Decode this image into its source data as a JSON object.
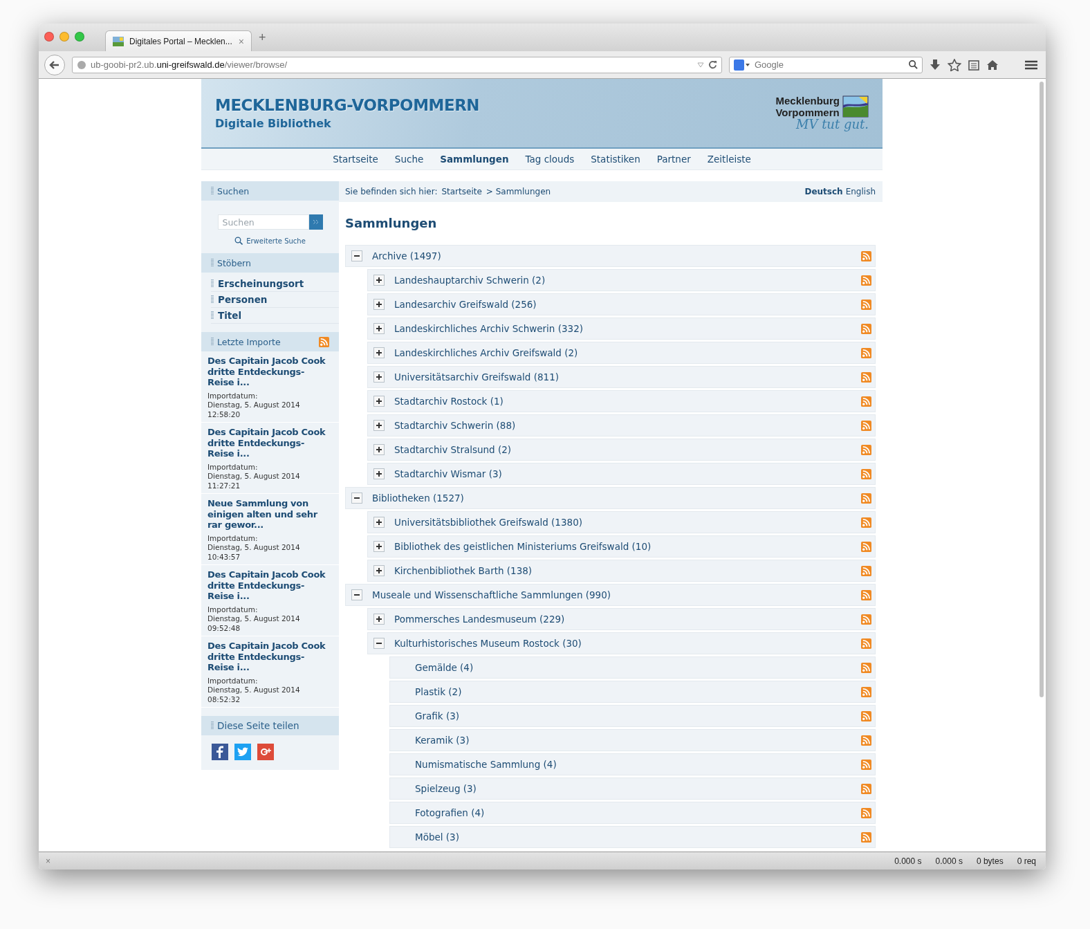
{
  "browser": {
    "tab_title": "Digitales Portal – Mecklen...",
    "close_tab": "×",
    "new_tab": "+",
    "url_prefix": "ub-goobi-pr2.ub.",
    "url_domain": "uni-greifswald.de",
    "url_path": "/viewer/browse/",
    "search_placeholder": "Google"
  },
  "header": {
    "title": "MECKLENBURG-VORPOMMERN",
    "subtitle": "Digitale Bibliothek",
    "logo_line1": "Mecklenburg",
    "logo_line2": "Vorpommern",
    "logo_slogan": "MV tut gut."
  },
  "nav": [
    {
      "label": "Startseite",
      "selected": false
    },
    {
      "label": "Suche",
      "selected": false
    },
    {
      "label": "Sammlungen",
      "selected": true
    },
    {
      "label": "Tag clouds",
      "selected": false
    },
    {
      "label": "Statistiken",
      "selected": false
    },
    {
      "label": "Partner",
      "selected": false
    },
    {
      "label": "Zeitleiste",
      "selected": false
    }
  ],
  "sidebar": {
    "search_title": "Suchen",
    "search_placeholder": "Suchen",
    "advanced_search": "Erweiterte Suche",
    "browse_title": "Stöbern",
    "browse_items": [
      "Erscheinungsort",
      "Personen",
      "Titel"
    ],
    "imports_title": "Letzte Importe",
    "imports": [
      {
        "title": "Des Capitain Jacob Cook dritte Entdeckungs-Reise i...",
        "label": "Importdatum:",
        "date": "Dienstag, 5. August 2014",
        "time": "12:58:20"
      },
      {
        "title": "Des Capitain Jacob Cook dritte Entdeckungs-Reise i...",
        "label": "Importdatum:",
        "date": "Dienstag, 5. August 2014",
        "time": "11:27:21"
      },
      {
        "title": "Neue Sammlung von einigen alten und sehr rar gewor...",
        "label": "Importdatum:",
        "date": "Dienstag, 5. August 2014",
        "time": "10:43:57"
      },
      {
        "title": "Des Capitain Jacob Cook dritte Entdeckungs-Reise i...",
        "label": "Importdatum:",
        "date": "Dienstag, 5. August 2014",
        "time": "09:52:48"
      },
      {
        "title": "Des Capitain Jacob Cook dritte Entdeckungs-Reise i...",
        "label": "Importdatum:",
        "date": "Dienstag, 5. August 2014",
        "time": "08:52:32"
      }
    ],
    "share_title": "Diese Seite teilen"
  },
  "breadcrumb": {
    "prefix": "Sie befinden sich hier:",
    "items": [
      "Startseite",
      "> Sammlungen"
    ]
  },
  "languages": [
    {
      "label": "Deutsch",
      "selected": true
    },
    {
      "label": "English",
      "selected": false
    }
  ],
  "page_title": "Sammlungen",
  "tree": [
    {
      "label": "Archive (1497)",
      "kind": "group",
      "expanded": true,
      "children": [
        {
          "label": "Landeshauptarchiv Schwerin (2)",
          "kind": "group",
          "expanded": false
        },
        {
          "label": "Landesarchiv Greifswald (256)",
          "kind": "group",
          "expanded": false
        },
        {
          "label": "Landeskirchliches Archiv Schwerin (332)",
          "kind": "group",
          "expanded": false
        },
        {
          "label": "Landeskirchliches Archiv Greifswald (2)",
          "kind": "group",
          "expanded": false
        },
        {
          "label": "Universitätsarchiv Greifswald (811)",
          "kind": "group",
          "expanded": false
        },
        {
          "label": "Stadtarchiv Rostock (1)",
          "kind": "group",
          "expanded": false
        },
        {
          "label": "Stadtarchiv Schwerin (88)",
          "kind": "group",
          "expanded": false
        },
        {
          "label": "Stadtarchiv Stralsund (2)",
          "kind": "group",
          "expanded": false
        },
        {
          "label": "Stadtarchiv Wismar (3)",
          "kind": "group",
          "expanded": false
        }
      ]
    },
    {
      "label": "Bibliotheken (1527)",
      "kind": "group",
      "expanded": true,
      "children": [
        {
          "label": "Universitätsbibliothek Greifswald (1380)",
          "kind": "group",
          "expanded": false
        },
        {
          "label": "Bibliothek des geistlichen Ministeriums Greifswald (10)",
          "kind": "group",
          "expanded": false
        },
        {
          "label": "Kirchenbibliothek Barth (138)",
          "kind": "group",
          "expanded": false
        }
      ]
    },
    {
      "label": "Museale und Wissenschaftliche Sammlungen (990)",
      "kind": "group",
      "expanded": true,
      "children": [
        {
          "label": "Pommersches Landesmuseum (229)",
          "kind": "group",
          "expanded": false
        },
        {
          "label": "Kulturhistorisches Museum Rostock (30)",
          "kind": "group",
          "expanded": true,
          "children": [
            {
              "label": "Gemälde (4)",
              "kind": "leaf"
            },
            {
              "label": "Plastik (2)",
              "kind": "leaf"
            },
            {
              "label": "Grafik (3)",
              "kind": "leaf"
            },
            {
              "label": "Keramik (3)",
              "kind": "leaf"
            },
            {
              "label": "Numismatische Sammlung (4)",
              "kind": "leaf"
            },
            {
              "label": "Spielzeug (3)",
              "kind": "leaf"
            },
            {
              "label": "Fotografien (4)",
              "kind": "leaf"
            },
            {
              "label": "Möbel (3)",
              "kind": "leaf"
            }
          ]
        }
      ]
    }
  ],
  "status_bar": {
    "close": "×",
    "stats": [
      "0.000 s",
      "0.000 s",
      "0 bytes",
      "0 req"
    ]
  }
}
